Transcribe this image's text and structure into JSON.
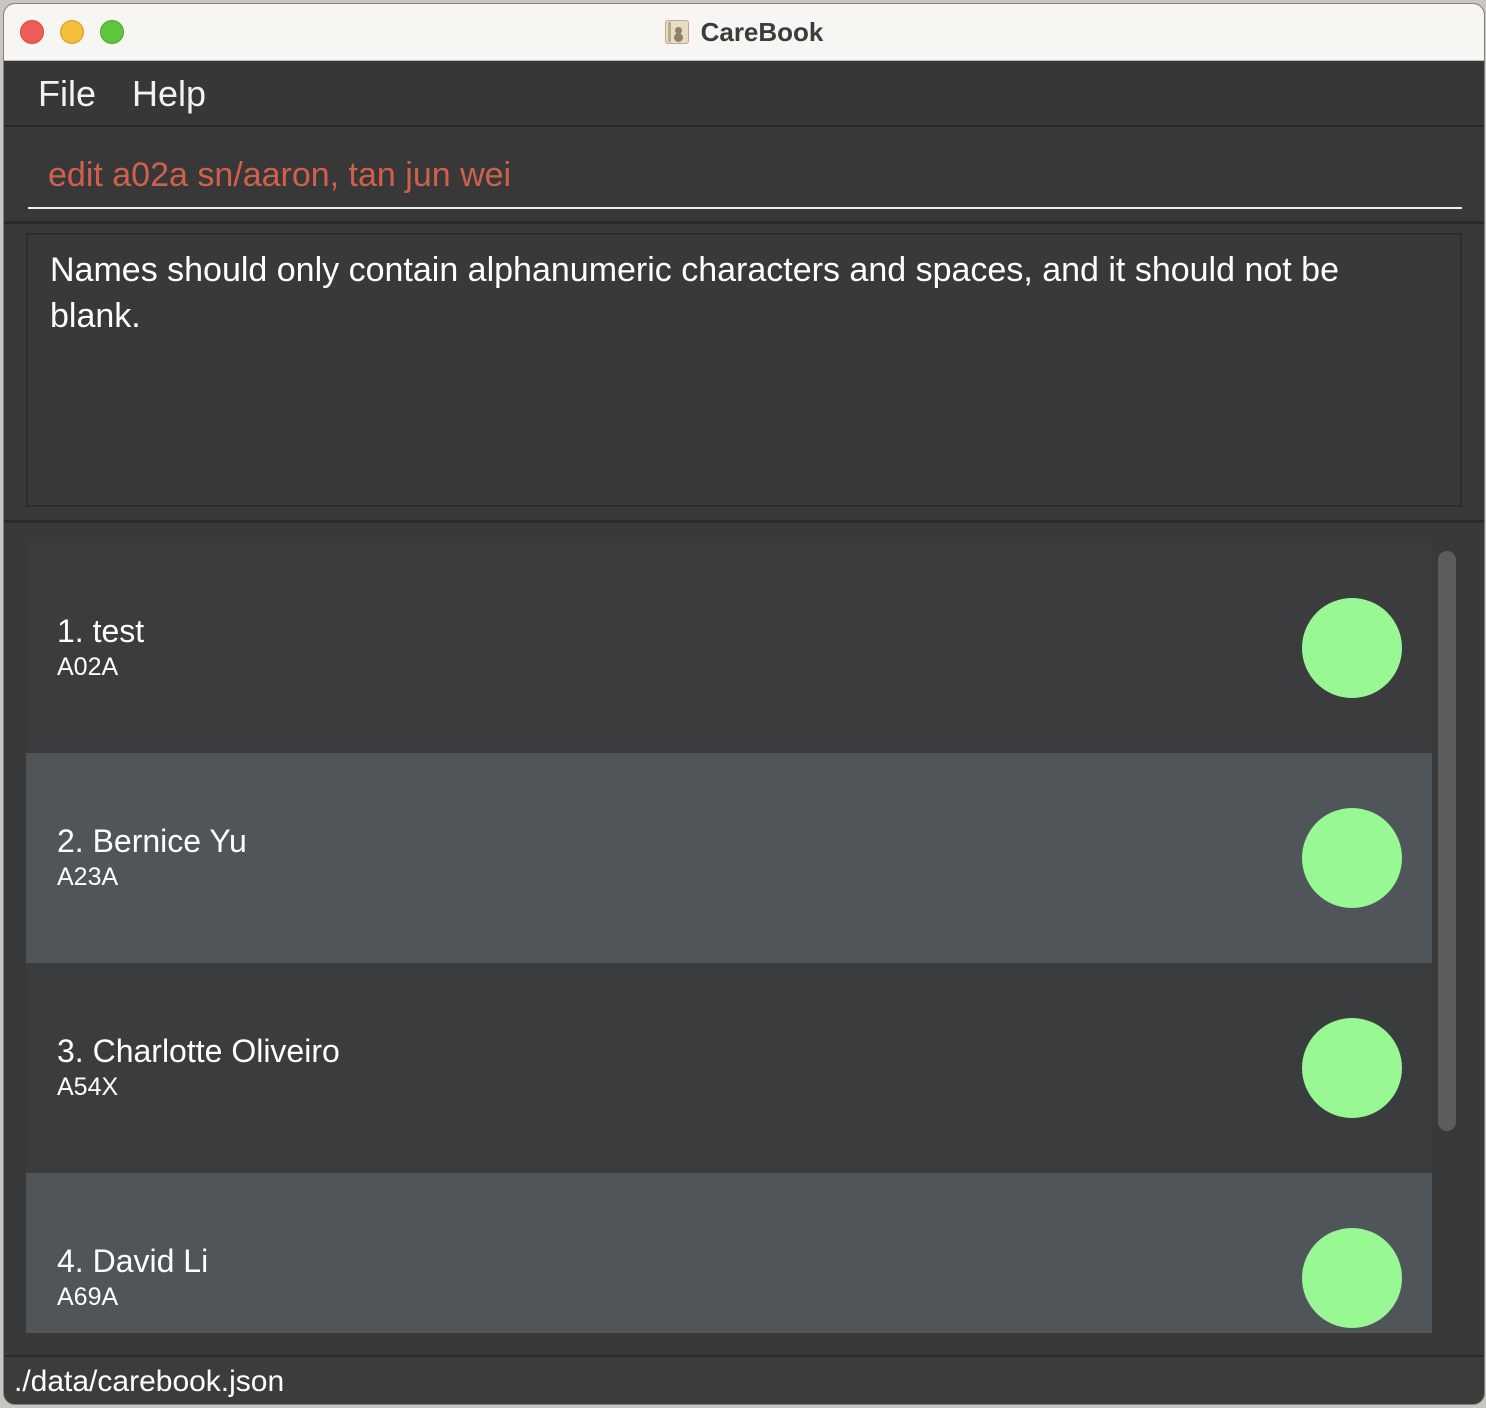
{
  "window": {
    "title": "CareBook"
  },
  "menu": {
    "file": "File",
    "help": "Help"
  },
  "command": {
    "value": "edit a02a sn/aaron, tan jun wei"
  },
  "result": {
    "message": "Names should only contain alphanumeric characters and spaces, and it should not be blank."
  },
  "persons": [
    {
      "name": "1. test",
      "id": "A02A",
      "status_color": "#98f894"
    },
    {
      "name": "2. Bernice Yu",
      "id": "A23A",
      "status_color": "#98f894"
    },
    {
      "name": "3. Charlotte Oliveiro",
      "id": "A54X",
      "status_color": "#98f894"
    },
    {
      "name": "4. David Li",
      "id": "A69A",
      "status_color": "#98f894"
    }
  ],
  "status_bar": {
    "path": "./data/carebook.json"
  },
  "colors": {
    "command_text": "#d0604e",
    "card_dark": "#3b3c3e",
    "card_light": "#50555a",
    "status_green": "#98f894"
  }
}
